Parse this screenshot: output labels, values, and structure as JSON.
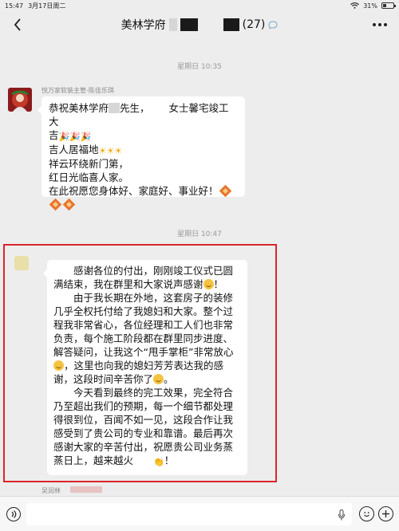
{
  "status_bar": {
    "time": "15:47",
    "date": "3月17日周二",
    "battery": "31%"
  },
  "header": {
    "title": "美林学府",
    "member_count": "(27)"
  },
  "messages": [
    {
      "time": "星期日 10:35",
      "sender": "悦万家软装主管-陈佳乐琪",
      "lines": [
        "恭祝美林学府",
        "先生，",
        "女士馨宅竣工大",
        "吉",
        "吉人居福地",
        "祥云环绕新门第，",
        "红日光临喜人家。",
        "在此祝愿您身体好、家庭好、事业好！"
      ]
    },
    {
      "time": "星期日 10:47",
      "paragraphs": [
        "感谢各位的付出，刚刚竣工仪式已圆满结束，我在群里和大家说声感谢",
        "！",
        "由于我长期在外地，这套房子的装修几乎全权托付给了我媳妇和大家。整个过程我非常省心，各位经理和工人们也非常负责，每个施工阶段都在群里同步进度、解答疑问，让我这个“甩手掌柜”非常放心",
        "，这里也向我的媳妇芳芳表达我的感谢，这段时间辛苦你了",
        "。",
        "今天看到最终的完工效果，完全符合乃至超出我们的预期，每一个细节都处理得很到位，百闻不如一见，这段合作让我感受到了贵公司的专业和靠谱。最后再次感谢大家的辛苦付出，祝愿贵公司业务蒸蒸日上，越来越火",
        "！"
      ]
    }
  ],
  "footer_peek": {
    "name": "吴润林"
  },
  "icons": {
    "back": "chevron-left-icon",
    "more": "more-dots-icon",
    "voice": "voice-icon",
    "mic": "mic-icon",
    "emoji": "emoji-icon",
    "plus": "plus-icon"
  },
  "colors": {
    "highlight": "#d9262c",
    "background": "#ededed"
  }
}
